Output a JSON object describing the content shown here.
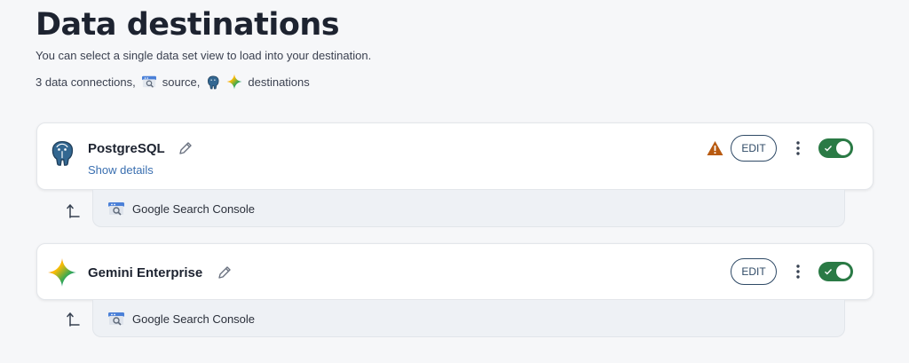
{
  "header": {
    "title": "Data destinations",
    "subtitle": "You can select a single data set view to load into your destination.",
    "summary_prefix": "3 data connections,",
    "summary_source": "source,",
    "summary_destinations": "destinations"
  },
  "destinations": [
    {
      "name": "PostgreSQL",
      "show_details": "Show details",
      "edit_label": "EDIT",
      "has_warning": true,
      "enabled": true,
      "source": "Google Search Console"
    },
    {
      "name": "Gemini Enterprise",
      "edit_label": "EDIT",
      "has_warning": false,
      "enabled": true,
      "source": "Google Search Console"
    }
  ],
  "colors": {
    "toggle_on": "#2a7a45",
    "warning": "#b85a10",
    "link": "#3a6fb0",
    "button_border": "#2f4a66"
  },
  "icons": {
    "postgres": "postgresql-elephant-icon",
    "gemini": "gemini-sparkle-icon",
    "source": "google-search-console-icon",
    "warning": "warning-triangle-icon",
    "edit": "pencil-icon",
    "menu": "kebab-menu-icon",
    "return": "return-arrow-icon"
  }
}
